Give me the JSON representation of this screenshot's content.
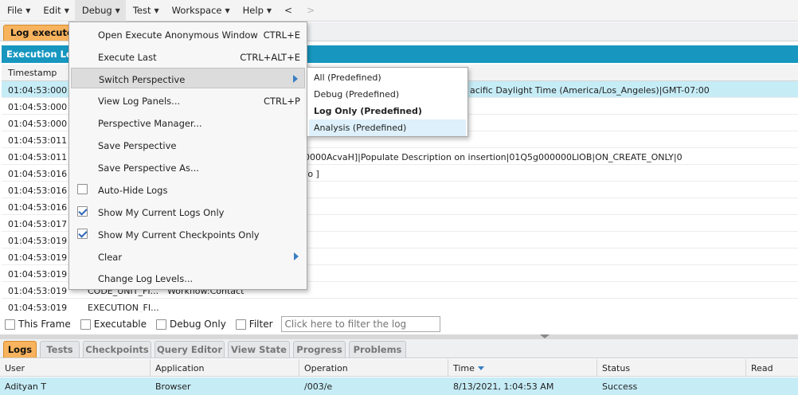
{
  "menubar": {
    "items": [
      {
        "name": "menu-file",
        "label": "File"
      },
      {
        "name": "menu-edit",
        "label": "Edit"
      },
      {
        "name": "menu-debug",
        "label": "Debug"
      },
      {
        "name": "menu-test",
        "label": "Test"
      },
      {
        "name": "menu-workspace",
        "label": "Workspace"
      },
      {
        "name": "menu-help",
        "label": "Help"
      }
    ],
    "back_glyph": "<",
    "forward_glyph": ">"
  },
  "log_tab": {
    "label": "Log executeA"
  },
  "execution_log": {
    "title": "Execution Log",
    "timestamp_header": "Timestamp",
    "rows": [
      {
        "ts": "01:04:53:000",
        "event": "",
        "details": "",
        "extra": "acific Daylight Time (America/Los_Angeles)|GMT-07:00"
      },
      {
        "ts": "01:04:53:000",
        "event": "",
        "details": "",
        "extra": ""
      },
      {
        "ts": "01:04:53:000",
        "event": "",
        "details": "",
        "extra": ""
      },
      {
        "ts": "01:04:53:011",
        "event": "",
        "details": "",
        "extra": ""
      },
      {
        "ts": "01:04:53:011",
        "event": "",
        "details": "",
        "extra": "0000AcvaH]|Populate Description on insertion|01Q5g000000LlOB|ON_CREATE_ONLY|0"
      },
      {
        "ts": "01:04:53:016",
        "event": "",
        "details": "",
        "extra": "to ]"
      },
      {
        "ts": "01:04:53:016",
        "event": "",
        "details": "",
        "extra": ""
      },
      {
        "ts": "01:04:53:016",
        "event": "",
        "details": "",
        "extra": ""
      },
      {
        "ts": "01:04:53:017",
        "event": "",
        "details": "",
        "extra": ""
      },
      {
        "ts": "01:04:53:019",
        "event": "",
        "details": "",
        "extra": ""
      },
      {
        "ts": "01:04:53:019",
        "event": "",
        "details": "",
        "extra": ""
      },
      {
        "ts": "01:04:53:019",
        "event": "",
        "details": "",
        "extra": ""
      },
      {
        "ts": "01:04:53:019",
        "event": "CODE_UNIT_FI...",
        "details": "Workflow:Contact",
        "extra": ""
      },
      {
        "ts": "01:04:53:019",
        "event": "EXECUTION_FI...",
        "details": "",
        "extra": ""
      }
    ]
  },
  "filter": {
    "this_frame": "This Frame",
    "executable": "Executable",
    "debug_only": "Debug Only",
    "filter": "Filter",
    "placeholder": "Click here to filter the log"
  },
  "bottom_tabs": [
    {
      "name": "tab-logs",
      "label": "Logs",
      "active": true
    },
    {
      "name": "tab-tests",
      "label": "Tests",
      "active": false
    },
    {
      "name": "tab-checkpoints",
      "label": "Checkpoints",
      "active": false
    },
    {
      "name": "tab-query-editor",
      "label": "Query Editor",
      "active": false
    },
    {
      "name": "tab-view-state",
      "label": "View State",
      "active": false
    },
    {
      "name": "tab-progress",
      "label": "Progress",
      "active": false
    },
    {
      "name": "tab-problems",
      "label": "Problems",
      "active": false
    }
  ],
  "logs_grid": {
    "headers": {
      "user": "User",
      "application": "Application",
      "operation": "Operation",
      "time": "Time",
      "status": "Status",
      "read": "Read"
    },
    "row": {
      "user": "Adityan T",
      "application": "Browser",
      "operation": "/003/e",
      "time": "8/13/2021, 1:04:53 AM",
      "status": "Success",
      "read": ""
    }
  },
  "debug_menu": {
    "items": [
      {
        "name": "menu-item-open-execute-anonymous",
        "label": "Open Execute Anonymous Window",
        "shortcut": "CTRL+E"
      },
      {
        "name": "menu-item-execute-last",
        "label": "Execute Last",
        "shortcut": "CTRL+ALT+E"
      },
      {
        "name": "menu-item-switch-perspective",
        "label": "Switch Perspective",
        "shortcut": ""
      },
      {
        "name": "menu-item-view-log-panels",
        "label": "View Log Panels...",
        "shortcut": "CTRL+P"
      },
      {
        "name": "menu-item-perspective-manager",
        "label": "Perspective Manager...",
        "shortcut": ""
      },
      {
        "name": "menu-item-save-perspective",
        "label": "Save Perspective",
        "shortcut": ""
      },
      {
        "name": "menu-item-save-perspective-as",
        "label": "Save Perspective As...",
        "shortcut": ""
      },
      {
        "name": "menu-item-auto-hide-logs",
        "label": "Auto-Hide Logs",
        "shortcut": ""
      },
      {
        "name": "menu-item-show-my-current-logs",
        "label": "Show My Current Logs Only",
        "shortcut": ""
      },
      {
        "name": "menu-item-show-my-current-checkpoints",
        "label": "Show My Current Checkpoints Only",
        "shortcut": ""
      },
      {
        "name": "menu-item-clear",
        "label": "Clear",
        "shortcut": ""
      },
      {
        "name": "menu-item-change-log-levels",
        "label": "Change Log Levels...",
        "shortcut": ""
      }
    ]
  },
  "perspective_submenu": {
    "items": [
      {
        "name": "perspective-all",
        "label": "All (Predefined)"
      },
      {
        "name": "perspective-debug",
        "label": "Debug (Predefined)"
      },
      {
        "name": "perspective-log-only",
        "label": "Log Only (Predefined)"
      },
      {
        "name": "perspective-analysis",
        "label": "Analysis (Predefined)"
      }
    ]
  },
  "colors": {
    "accent_orange": "#f7b35d",
    "header_blue": "#1797c0",
    "selection": "#c6ecf6"
  }
}
